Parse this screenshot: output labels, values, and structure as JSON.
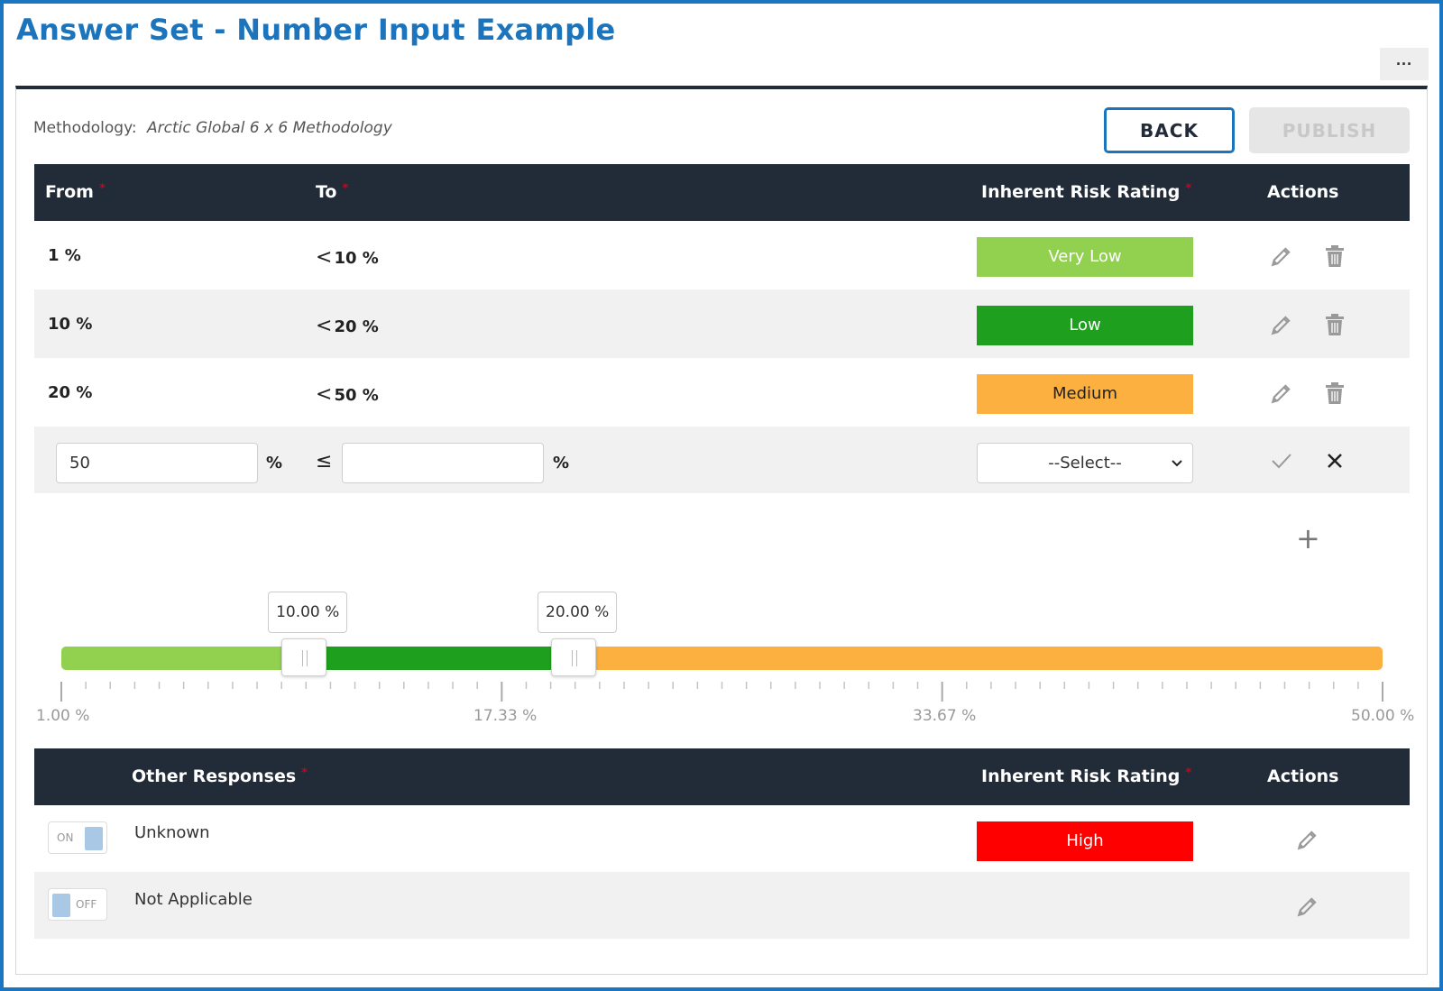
{
  "page": {
    "title": "Answer Set - Number Input Example",
    "more_label": "···"
  },
  "methodology": {
    "label": "Methodology:",
    "value": "Arctic Global 6 x 6 Methodology"
  },
  "buttons": {
    "back": "BACK",
    "publish": "PUBLISH"
  },
  "range_table": {
    "headers": {
      "from": "From",
      "to": "To",
      "rating": "Inherent Risk Rating",
      "actions": "Actions",
      "required": "*"
    },
    "rows": [
      {
        "from": "1 %",
        "to_op": "<",
        "to": "10 %",
        "rating": "Very Low",
        "rating_color": "#92d050",
        "rating_text_color": "#ffffff"
      },
      {
        "from": "10 %",
        "to_op": "<",
        "to": "20 %",
        "rating": "Low",
        "rating_color": "#1ea01e",
        "rating_text_color": "#ffffff"
      },
      {
        "from": "20 %",
        "to_op": "<",
        "to": "50 %",
        "rating": "Medium",
        "rating_color": "#fbb040",
        "rating_text_color": "#222222"
      }
    ],
    "edit_row": {
      "from_value": "50",
      "unit": "%",
      "op": "≤",
      "to_value": "",
      "select_value": "--Select--"
    }
  },
  "slider": {
    "min": 1.0,
    "max": 50.0,
    "handles": [
      10.0,
      20.0
    ],
    "handle_labels": [
      "10.00 %",
      "20.00 %"
    ],
    "tick_labels": [
      "1.00 %",
      "17.33 %",
      "33.67 %",
      "50.00 %"
    ],
    "colors": [
      "#92d050",
      "#1ea01e",
      "#fbb040"
    ]
  },
  "other_table": {
    "headers": {
      "responses": "Other Responses",
      "rating": "Inherent Risk Rating",
      "actions": "Actions",
      "required": "*"
    },
    "rows": [
      {
        "toggle": "ON",
        "label": "Unknown",
        "rating": "High",
        "rating_color": "#ff0000"
      },
      {
        "toggle": "OFF",
        "label": "Not Applicable",
        "rating": ""
      }
    ]
  },
  "icons": {
    "edit": "pencil-icon",
    "delete": "trash-icon",
    "confirm": "check-icon",
    "cancel": "close-icon",
    "add": "plus-icon"
  }
}
